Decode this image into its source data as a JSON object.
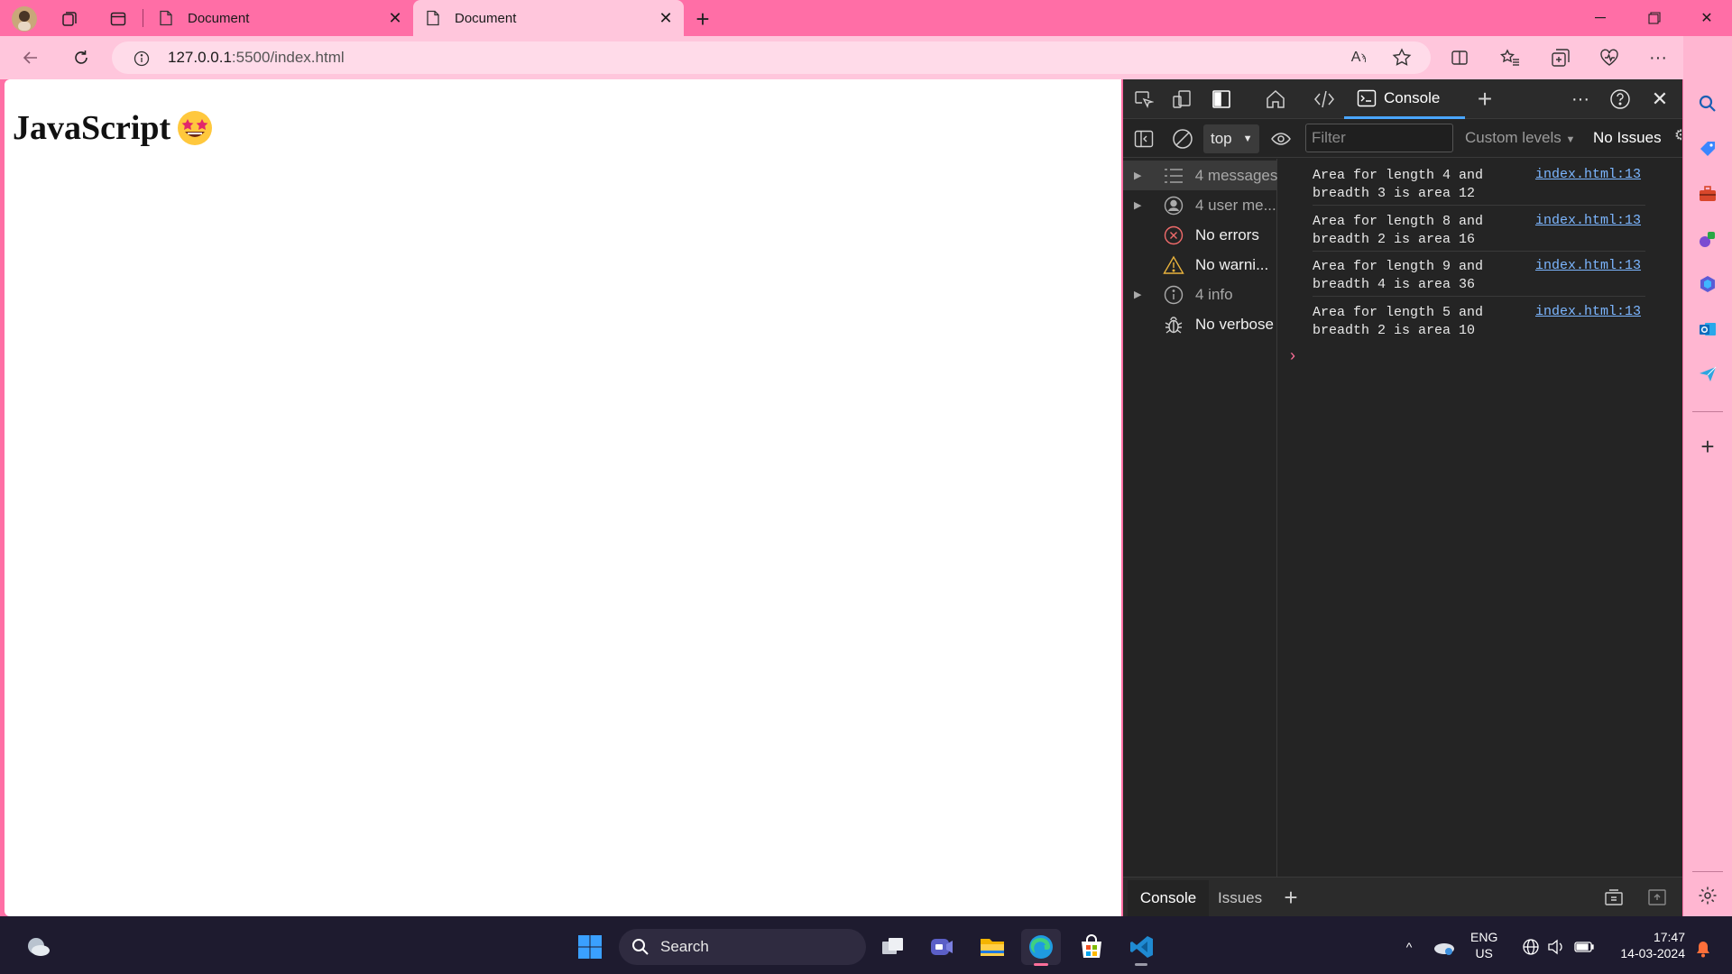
{
  "browser": {
    "tabs": [
      {
        "label": "Document",
        "active": false
      },
      {
        "label": "Document",
        "active": true
      }
    ],
    "address": {
      "host": "127.0.0.1",
      "path": ":5500/index.html"
    }
  },
  "page": {
    "heading": "JavaScript",
    "heading_emoji": "🤩"
  },
  "devtools": {
    "active_panel": "Console",
    "context": "top",
    "filter_placeholder": "Filter",
    "levels_label": "Custom levels",
    "issues_label": "No Issues",
    "sidebar": [
      {
        "label": "4 messages",
        "icon": "list-icon",
        "expandable": true
      },
      {
        "label": "4 user me...",
        "icon": "user-icon",
        "expandable": true
      },
      {
        "label": "No errors",
        "icon": "error-icon",
        "expandable": false
      },
      {
        "label": "No warni...",
        "icon": "warning-icon",
        "expandable": false
      },
      {
        "label": "4 info",
        "icon": "info-icon",
        "expandable": true
      },
      {
        "label": "No verbose",
        "icon": "bug-icon",
        "expandable": false
      }
    ],
    "messages": [
      {
        "text": "Area for length 4 and\nbreadth 3 is area 12",
        "source": "index.html:13"
      },
      {
        "text": "Area for length 8 and\nbreadth 2 is area 16",
        "source": "index.html:13"
      },
      {
        "text": "Area for length 9 and\nbreadth 4 is area 36",
        "source": "index.html:13"
      },
      {
        "text": "Area for length 5 and\nbreadth 2 is area 10",
        "source": "index.html:13"
      }
    ],
    "drawer_tabs": [
      "Console",
      "Issues"
    ]
  },
  "taskbar": {
    "search_label": "Search",
    "lang_line1": "ENG",
    "lang_line2": "US",
    "time": "17:47",
    "date": "14-03-2024"
  },
  "colors": {
    "titlebar": "#ff6ea6",
    "toolbar": "#ffc6dc",
    "devtools_bg": "#242424",
    "link": "#7cb6ff",
    "accent": "#4aa6ff"
  }
}
